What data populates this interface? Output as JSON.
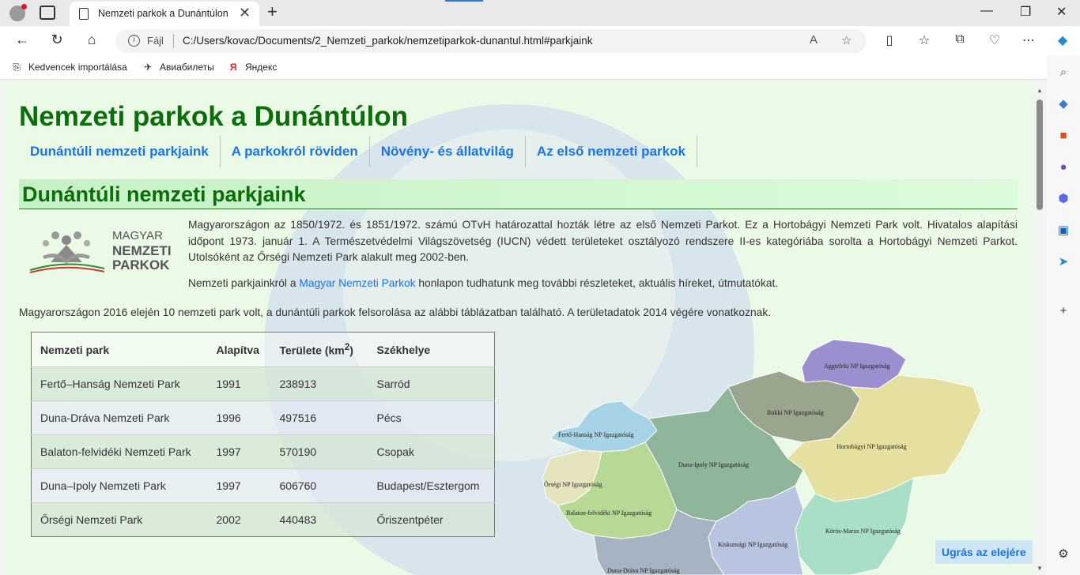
{
  "browser": {
    "tab_title": "Nemzeti parkok a Dunántúlon",
    "url_protocol": "Fájl",
    "url": "C:/Users/kovac/Documents/2_Nemzeti_parkok/nemzetiparkok-dunantul.html#parkjaink",
    "favorites": [
      {
        "label": "Kedvencek importálása",
        "icon": "import-icon"
      },
      {
        "label": "Авиабилеты",
        "icon": "plane-icon"
      },
      {
        "label": "Яндекс",
        "icon": "yandex-icon"
      }
    ]
  },
  "page": {
    "title": "Nemzeti parkok a Dunántúlon",
    "nav": [
      "Dunántúli nemzeti parkjaink",
      "A parkokról röviden",
      "Növény- és állatvilág",
      "Az első nemzeti parkok"
    ],
    "section_title": "Dunántúli nemzeti parkjaink",
    "logo_text": [
      "MAGYAR",
      "NEMZETI",
      "PARKOK"
    ],
    "intro_p1": "Magyarországon az 1850/1972. és 1851/1972. számú OTvH határozattal hozták létre az első Nemzeti Parkot. Ez a Hortobágyi Nemzeti Park volt. Hivatalos alapítási időpont 1973. január 1. A Természetvédelmi Világszövetség (IUCN) védett területeket osztályozó rendszere II-es kategóriába sorolta a Hortobágyi Nemzeti Parkot. Utolsóként az Őrségi Nemzeti Park alakult meg 2002-ben.",
    "intro_p2_before": "Nemzeti parkjainkról a ",
    "intro_p2_link": "Magyar Nemzeti Parkok",
    "intro_p2_after": " honlapon tudhatunk meg további részleteket, aktuális híreket, útmutatókat.",
    "intro_p3": "Magyarországon 2016 elején 10 nemzeti park volt, a dunántúli parkok felsorolása az alábbi táblázatban található. A területadatok 2014 végére vonatkoznak.",
    "table": {
      "headers": [
        "Nemzeti park",
        "Alapítva",
        "Területe (km",
        "2",
        ")",
        "Székhelye"
      ],
      "rows": [
        [
          "Fertő–Hanság Nemzeti Park",
          "1991",
          "238913",
          "Sarród"
        ],
        [
          "Duna-Dráva Nemzeti Park",
          "1996",
          "497516",
          "Pécs"
        ],
        [
          "Balaton-felvidéki Nemzeti Park",
          "1997",
          "570190",
          "Csopak"
        ],
        [
          "Duna–Ipoly Nemzeti Park",
          "1997",
          "606760",
          "Budapest/Esztergom"
        ],
        [
          "Őrségi Nemzeti Park",
          "2002",
          "440483",
          "Őriszentpéter"
        ]
      ]
    },
    "map_labels": {
      "aggteleki": "Aggteleki NP Igazgatóság",
      "bukki": "Bükki NP Igazgatóság",
      "hortobagyi": "Hortobágyi NP Igazgatóság",
      "ferto": "Fertő-Hanság NP Igazgatóság",
      "dunaipoly": "Duna-Ipoly NP Igazgatóság",
      "orsegi": "Őrségi NP Igazgatóság",
      "balaton": "Balaton-felvidéki NP Igazgatóság",
      "korosmaros": "Körös-Maros NP Igazgatóság",
      "kiskunsagi": "Kiskunsági NP Igazgatóság",
      "dunadrava": "Duna-Dráva NP Igazgatóság"
    },
    "back_to_top": "Ugrás az elejére"
  }
}
